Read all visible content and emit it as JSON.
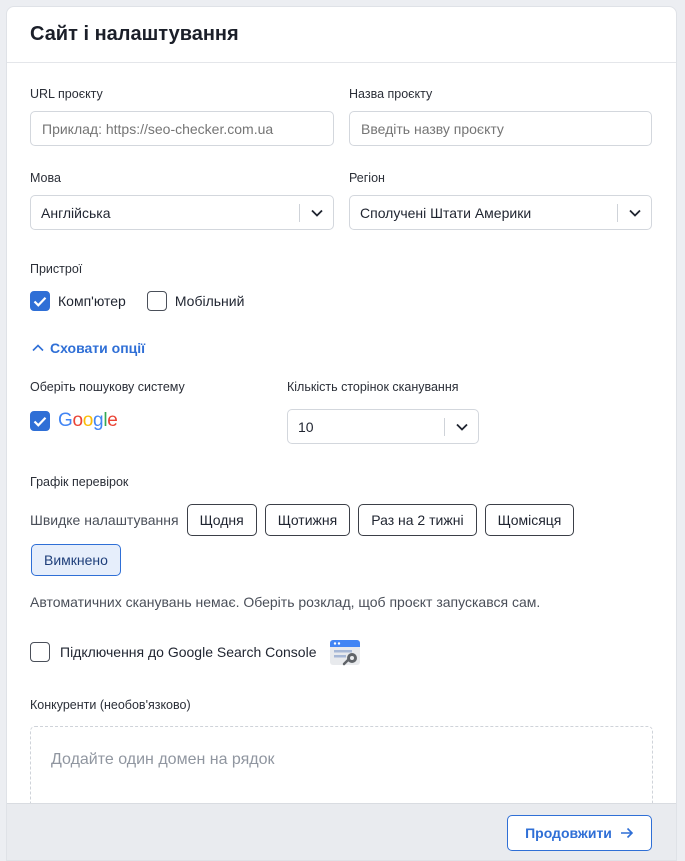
{
  "header": {
    "title": "Сайт і налаштування"
  },
  "form": {
    "url": {
      "label": "URL проєкту",
      "placeholder": "Приклад: https://seo-checker.com.ua"
    },
    "name": {
      "label": "Назва проєкту",
      "placeholder": "Введіть назву проєкту"
    },
    "language": {
      "label": "Мова",
      "value": "Англійська"
    },
    "region": {
      "label": "Регіон",
      "value": "Сполучені Штати Америки"
    },
    "devices": {
      "label": "Пристрої",
      "desktop": {
        "label": "Комп'ютер",
        "checked": true
      },
      "mobile": {
        "label": "Мобільний",
        "checked": false
      }
    },
    "toggle_options": "Сховати опції",
    "search_engine": {
      "label": "Оберіть пошукову систему",
      "engine": "Google",
      "checked": true
    },
    "pages": {
      "label": "Кількість сторінок сканування",
      "value": "10"
    },
    "schedule": {
      "label": "Графік перевірок",
      "quick_label": "Швидке налаштування",
      "options": [
        "Щодня",
        "Щотижня",
        "Раз на 2 тижні",
        "Щомісяця"
      ],
      "off": "Вимкнено",
      "hint": "Автоматичних сканувань немає. Оберіть розклад, щоб проєкт запускався сам."
    },
    "gsc": {
      "label": "Підключення до Google Search Console",
      "checked": false,
      "icon": "search-console-icon"
    },
    "competitors": {
      "label": "Конкуренти (необов'язково)",
      "placeholder": "Додайте один домен на рядок"
    }
  },
  "footer": {
    "next_label": "Продовжити"
  },
  "colors": {
    "accent": "#2f6fd6",
    "google_blue": "#4285F4",
    "google_red": "#EA4335",
    "google_yellow": "#FBBC05",
    "google_green": "#34A853"
  }
}
